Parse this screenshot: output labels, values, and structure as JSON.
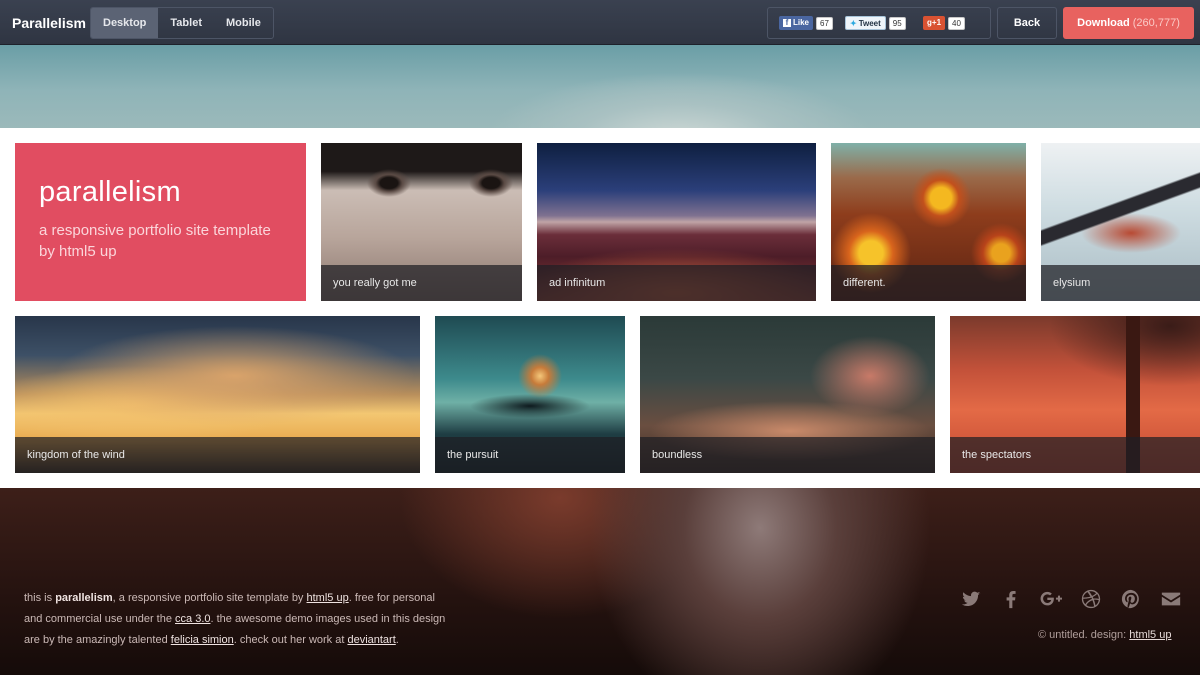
{
  "topbar": {
    "brand": "Parallelism",
    "devices": [
      "Desktop",
      "Tablet",
      "Mobile"
    ],
    "facebook": {
      "label": "Like",
      "count": "67"
    },
    "twitter": {
      "label": "Tweet",
      "count": "95"
    },
    "gplus": {
      "label": "+1",
      "count": "40"
    },
    "back_label": "Back",
    "download_label": "Download",
    "download_count": "(260,777)"
  },
  "intro": {
    "title": "parallelism",
    "subtitle": "a responsive portfolio site template by html5 up",
    "color": "#e14d61"
  },
  "tiles_row1": [
    "you really got me",
    "ad infinitum",
    "different.",
    "elysium"
  ],
  "tiles_row2": [
    "kingdom of the wind",
    "the pursuit",
    "boundless",
    "the spectators"
  ],
  "footer": {
    "p1": "this is ",
    "name": "parallelism",
    "p2": ", a responsive portfolio site template by ",
    "link1": "html5 up",
    "p3": ". free for personal and commercial use under the ",
    "link2": "cca 3.0",
    "p4": ". the awesome demo images used in this design are by the amazingly talented ",
    "link3": "felicia simion",
    "p5": ". check out her work at ",
    "link4": "deviantart",
    "p6": ".",
    "credit_prefix": "© untitled. design: ",
    "credit_link": "html5 up",
    "icons": [
      "twitter-icon",
      "facebook-icon",
      "googleplus-icon",
      "dribbble-icon",
      "pinterest-icon",
      "email-icon"
    ]
  }
}
